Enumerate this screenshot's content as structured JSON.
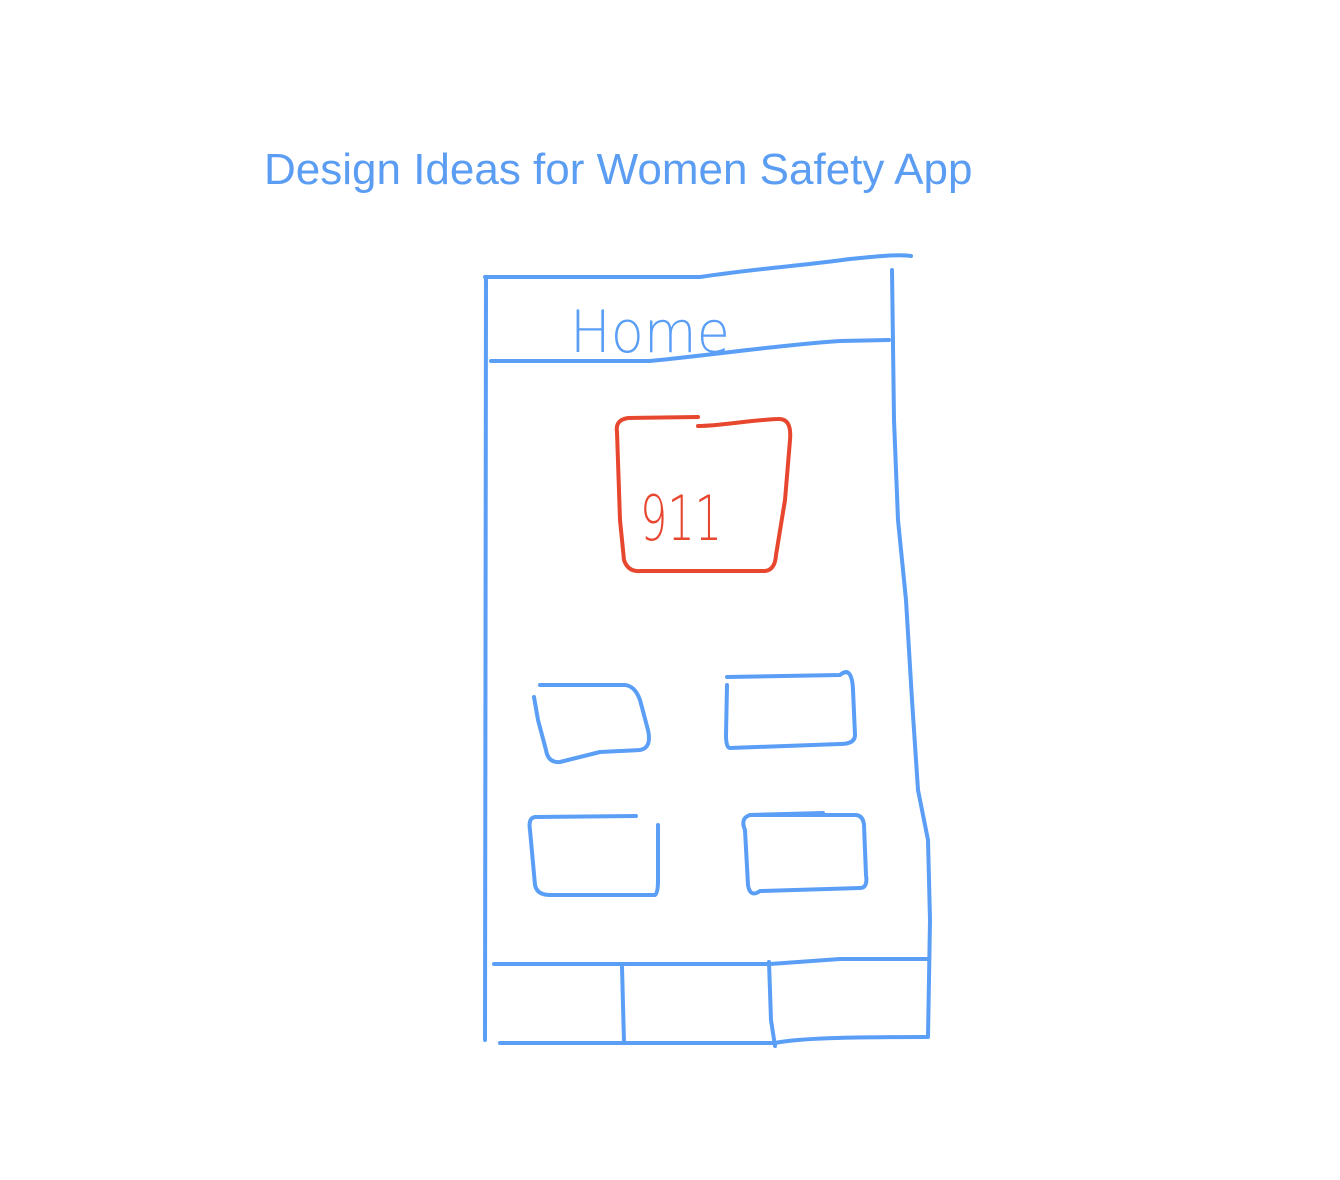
{
  "title": "Design Ideas for Women Safety App",
  "phone": {
    "header_label": "Home",
    "emergency_button_label": "911"
  },
  "colors": {
    "sketch_blue": "#5A9EF6",
    "emergency_red": "#E8472F"
  }
}
